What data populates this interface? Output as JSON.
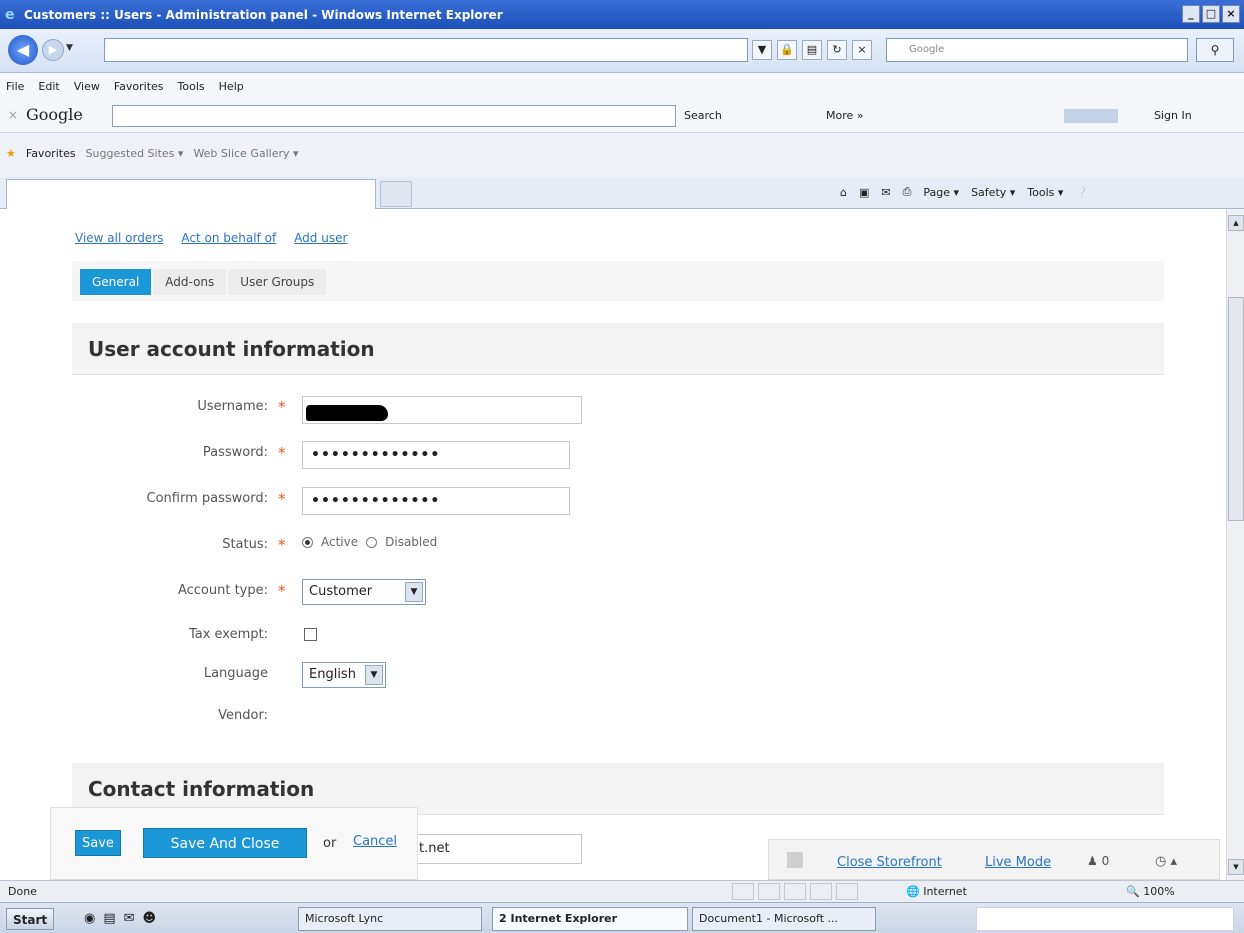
{
  "window": {
    "title": "Customers :: Users - Administration panel - Windows Internet Explorer",
    "buttons": [
      "_",
      "□",
      "×"
    ]
  },
  "browser": {
    "search_placeholder": "Google",
    "menu": [
      "File",
      "Edit",
      "View",
      "Favorites",
      "Tools",
      "Help"
    ],
    "google_bar": {
      "logo": "Google",
      "search_label": "Search",
      "more_label": "More »",
      "sign_in": "Sign In"
    },
    "favorites": {
      "label": "Favorites",
      "items": [
        "Suggested Sites ▾",
        "Web Slice Gallery ▾"
      ]
    },
    "commands": [
      "Page ▾",
      "Safety ▾",
      "Tools ▾"
    ]
  },
  "page": {
    "top_links": [
      "View all orders",
      "Act on behalf of",
      "Add user"
    ],
    "tabs": [
      {
        "label": "General",
        "active": true
      },
      {
        "label": "Add-ons",
        "active": false
      },
      {
        "label": "User Groups",
        "active": false
      }
    ],
    "account_section": "User account information",
    "contact_section": "Contact information",
    "form": {
      "username_label": "Username:",
      "password_label": "Password:",
      "password_value": "•••••••••••••",
      "confirm_label": "Confirm password:",
      "confirm_value": "•••••••••••••",
      "status_label": "Status:",
      "status_options": [
        "Active",
        "Disabled"
      ],
      "status_selected": "Active",
      "account_type_label": "Account type:",
      "account_type_value": "Customer",
      "tax_exempt_label": "Tax exempt:",
      "tax_exempt_checked": false,
      "language_label": "Language",
      "language_value": "English",
      "vendor_label": "Vendor:",
      "required_mark": "*",
      "email_value": "t.net"
    },
    "actions": {
      "save": "Save",
      "save_close": "Save And Close",
      "or": "or",
      "cancel": "Cancel"
    },
    "storefront": {
      "close": "Close Storefront",
      "live": "Live Mode",
      "users": "0"
    }
  },
  "status": {
    "text": "Done",
    "zone": "Internet",
    "zoom": "100%"
  },
  "taskbar": {
    "start": "Start",
    "tasks": [
      "Microsoft Lync",
      "2 Internet Explorer",
      "Document1 - Microsoft ..."
    ]
  },
  "colors": {
    "accent": "#1b96d6",
    "link": "#2a74c4",
    "required": "#e05a1f"
  }
}
